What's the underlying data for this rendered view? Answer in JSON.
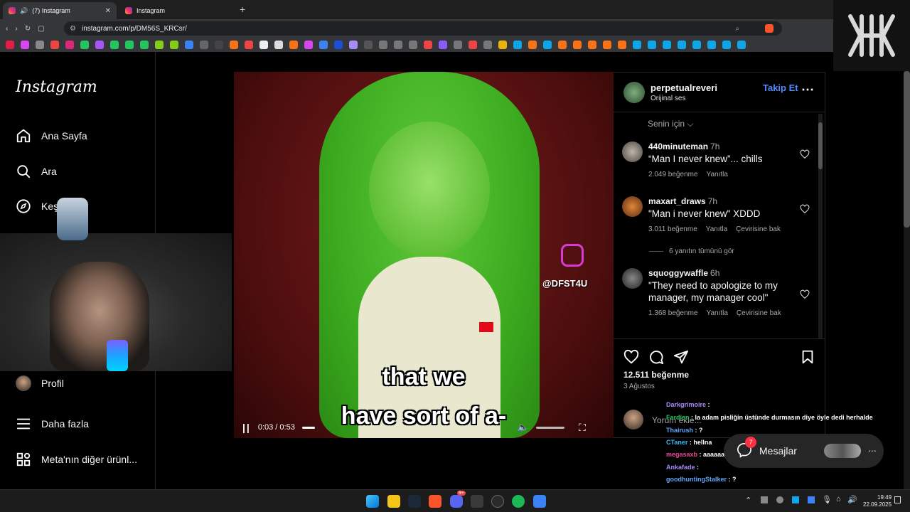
{
  "browser": {
    "tabs": [
      {
        "label": "(7) Instagram",
        "active": true,
        "audio_icon": "speaker-icon"
      },
      {
        "label": "Instagram",
        "active": false
      }
    ],
    "new_tab_label": "+",
    "url": "instagram.com/p/DM56S_KRCsr/"
  },
  "sidebar": {
    "logo": "Instagram",
    "items": [
      {
        "label": "Ana Sayfa",
        "icon": "home-icon"
      },
      {
        "label": "Ara",
        "icon": "search-icon"
      },
      {
        "label": "Keşfet",
        "icon": "compass-icon"
      },
      {
        "label": "Profil",
        "icon": "avatar"
      },
      {
        "label": "Daha fazla",
        "icon": "menu-icon"
      },
      {
        "label": "Meta'nın diğer ürünl...",
        "icon": "grid-icon"
      }
    ]
  },
  "video": {
    "watermark": "@DFST4U",
    "subtitle_line1": "that we",
    "subtitle_line2": "have sort of a-",
    "time": "0:03 / 0:53"
  },
  "post": {
    "username": "perpetualreveri",
    "audio": "Orijinal ses",
    "follow_label": "Takip Et",
    "sort_label": "Senin için",
    "likes": "12.511 beğenme",
    "date": "3 Ağustos",
    "comment_placeholder": "Yorum ekle...",
    "comments": [
      {
        "user": "440minuteman",
        "time": "7h",
        "text": "“Man I never knew”... chills",
        "likes": "2.049 beğenme",
        "reply": "Yanıtla",
        "translate": ""
      },
      {
        "user": "maxart_draws",
        "time": "7h",
        "text": "\"Man i never knew\" XDDD",
        "likes": "3.011 beğenme",
        "reply": "Yanıtla",
        "translate": "Çevirisine bak"
      },
      {
        "user": "squoggywaffle",
        "time": "6h",
        "text": "\"They need to apologize to my manager, my manager cool\"",
        "likes": "1.368 beğenme",
        "reply": "Yanıtla",
        "translate": "Çevirisine bak"
      }
    ],
    "view_replies": "6 yanıtın tümünü gör"
  },
  "chat": [
    {
      "user": "Darkgrimoire",
      "text": ":",
      "color": "#a78bfa"
    },
    {
      "user": "Fardien",
      "text": ": la adam pisliğin üstünde durmasın diye öyle dedi herhalde",
      "color": "#22c55e"
    },
    {
      "user": "Thairush",
      "text": ": ?",
      "color": "#60a5fa"
    },
    {
      "user": "CTaner",
      "text": ": hellna",
      "color": "#38bdf8"
    },
    {
      "user": "megasaxb",
      "text": ": aaaaaaaaa",
      "color": "#ec4899"
    },
    {
      "user": "Ankafade",
      "text": ":",
      "color": "#a78bfa"
    },
    {
      "user": "goodhuntingStalker",
      "text": ": ?",
      "color": "#60a5fa"
    }
  ],
  "messages": {
    "label": "Mesajlar",
    "badge": "7"
  },
  "taskbar": {
    "time": "19:49",
    "date": "22.09.2025",
    "discord_badge": "9+"
  },
  "colors": {
    "ig_bg": "#000000",
    "link_blue": "#4f8cff",
    "panel_border": "#262626"
  }
}
